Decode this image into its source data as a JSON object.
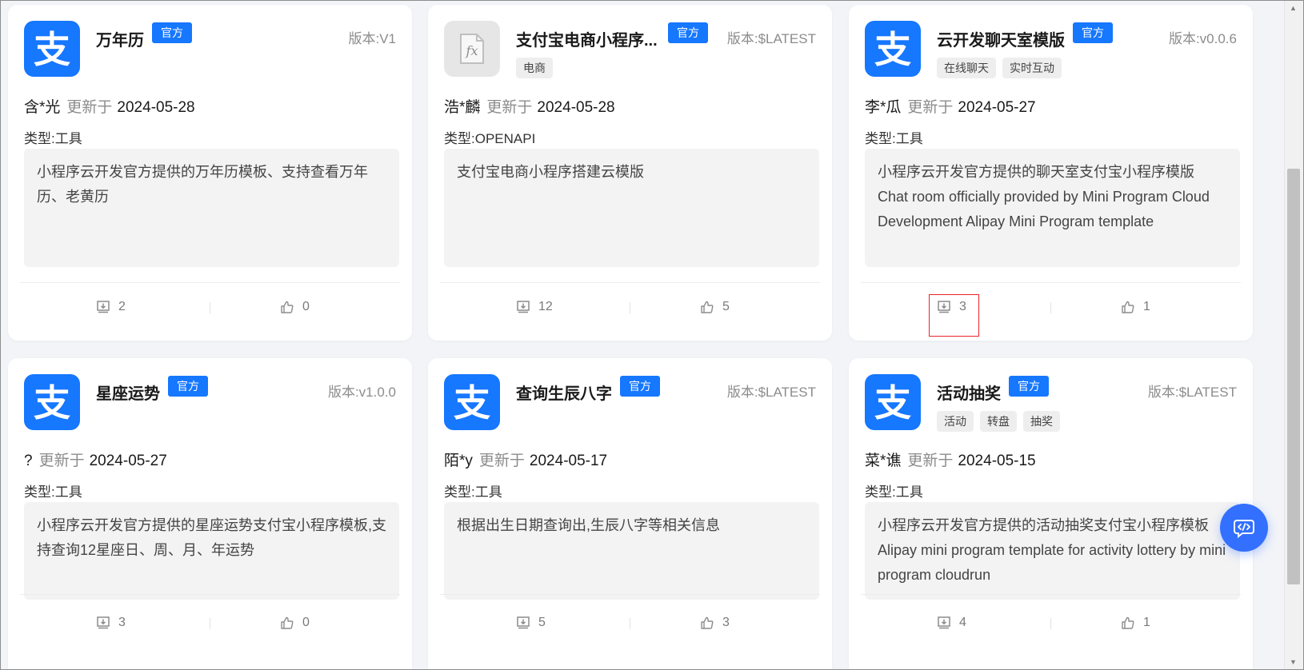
{
  "colors": {
    "brand": "#1677ff",
    "badge_bg": "#1677ff",
    "fab": "#3370ff",
    "highlight": "#e8242b"
  },
  "labels": {
    "official": "官方",
    "updated": "更新于",
    "version_prefix": "版本:",
    "type_prefix": "类型:"
  },
  "cards": [
    {
      "icon": "alipay-logo-icon",
      "title": "万年历",
      "official": "官方",
      "version": "版本:V1",
      "tags": [],
      "author": "含*光",
      "updated": "更新于",
      "date": "2024-05-28",
      "type": "类型:工具",
      "description": "小程序云开发官方提供的万年历模板、支持查看万年历、老黄历",
      "downloads": "2",
      "likes": "0"
    },
    {
      "icon": "function-fx-icon",
      "title": "支付宝电商小程序...",
      "official": "官方",
      "version": "版本:$LATEST",
      "tags": [
        "电商"
      ],
      "author": "浩*麟",
      "updated": "更新于",
      "date": "2024-05-28",
      "type": "类型:OPENAPI",
      "description": "支付宝电商小程序搭建云模版",
      "downloads": "12",
      "likes": "5"
    },
    {
      "icon": "alipay-logo-icon",
      "title": "云开发聊天室模版",
      "official": "官方",
      "version": "版本:v0.0.6",
      "tags": [
        "在线聊天",
        "实时互动"
      ],
      "author": "李*瓜",
      "updated": "更新于",
      "date": "2024-05-27",
      "type": "类型:工具",
      "description": "小程序云开发官方提供的聊天室支付宝小程序模版 Chat room officially provided by Mini Program Cloud Development Alipay Mini Program template",
      "downloads": "3",
      "likes": "1"
    },
    {
      "icon": "alipay-logo-icon",
      "title": "星座运势",
      "official": "官方",
      "version": "版本:v1.0.0",
      "tags": [],
      "author": "?",
      "updated": "更新于",
      "date": "2024-05-27",
      "type": "类型:工具",
      "description": "小程序云开发官方提供的星座运势支付宝小程序模板,支持查询12星座日、周、月、年运势",
      "downloads": "3",
      "likes": "0"
    },
    {
      "icon": "alipay-logo-icon",
      "title": "查询生辰八字",
      "official": "官方",
      "version": "版本:$LATEST",
      "tags": [],
      "author": "陌*y",
      "updated": "更新于",
      "date": "2024-05-17",
      "type": "类型:工具",
      "description": "根据出生日期查询出,生辰八字等相关信息",
      "downloads": "5",
      "likes": "3"
    },
    {
      "icon": "alipay-logo-icon",
      "title": "活动抽奖",
      "official": "官方",
      "version": "版本:$LATEST",
      "tags": [
        "活动",
        "转盘",
        "抽奖"
      ],
      "author": "菜*谯",
      "updated": "更新于",
      "date": "2024-05-15",
      "type": "类型:工具",
      "description": "小程序云开发官方提供的活动抽奖支付宝小程序模板 Alipay mini program template for activity lottery by mini program cloudrun",
      "downloads": "4",
      "likes": "1"
    }
  ],
  "fab_icon": "code-chat-icon",
  "highlighted": "download-stat-card-3"
}
